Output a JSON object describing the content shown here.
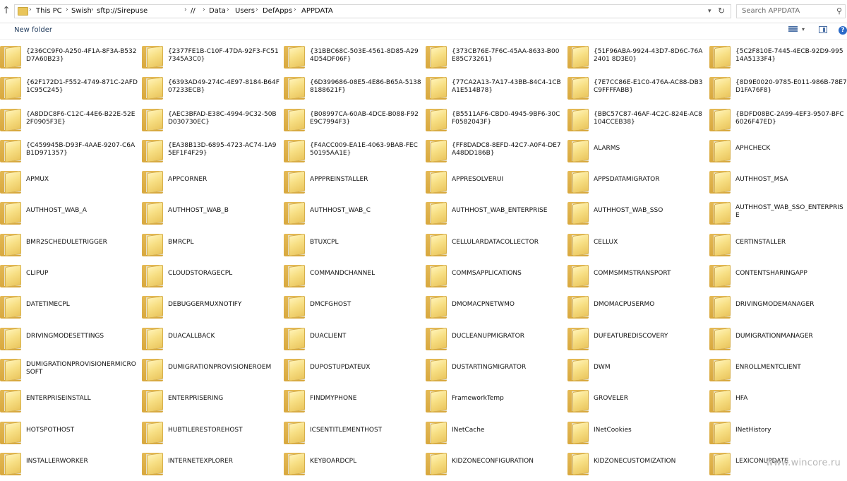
{
  "address": {
    "crumbs": [
      "This PC",
      "Swish",
      "sftp://Sirepuse",
      "//",
      "Data",
      "Users",
      "DefApps",
      "APPDATA"
    ]
  },
  "search": {
    "placeholder": "Search APPDATA"
  },
  "commands": {
    "new_folder": "New folder"
  },
  "items": [
    "{236CC9F0-A250-4F1A-8F3A-B532D7A60B23}",
    "{2377FE1B-C10F-47DA-92F3-FC517345A3C0}",
    "{31BBC68C-503E-4561-8D85-A294D54DF06F}",
    "{373CB76E-7F6C-45AA-8633-B00E85C73261}",
    "{51F96ABA-9924-43D7-8D6C-76A2401 8D3E0}",
    "{5C2F810E-7445-4ECB-92D9-99514A5133F4}",
    "{62F172D1-F552-4749-871C-2AFD1C95C245}",
    "{6393AD49-274C-4E97-8184-B64F07233ECB}",
    "{6D399686-08E5-4E86-B65A-51388188621F}",
    "{77CA2A13-7A17-43BB-84C4-1CBA1E514B78}",
    "{7E7CC86E-E1C0-476A-AC88-DB3C9FFFFABB}",
    "{8D9E0020-9785-E011-986B-78E7D1FA76F8}",
    "{A8DDC8F6-C12C-44E6-B22E-52E2F0905F3E}",
    "{AEC3BFAD-E38C-4994-9C32-50BD030730EC}",
    "{B08997CA-60AB-4DCE-B088-F92E9C7994F3}",
    "{B5511AF6-CBD0-4945-9BF6-30CF0582043F}",
    "{BBC57C87-46AF-4C2C-824E-AC8104CCEB38}",
    "{BDFD08BC-2A99-4EF3-9507-BFC6026F47ED}",
    "{C459945B-D93F-4AAE-9207-C6AB1D971357}",
    "{EA38B13D-6895-4723-AC74-1A95EF1F4F29}",
    "{F4ACC009-EA1E-4063-9BAB-FEC50195AA1E}",
    "{FF8DADC8-8EFD-42C7-A0F4-DE7A48DD186B}",
    "ALARMS",
    "APHCHECK",
    "APMUX",
    "APPCORNER",
    "APPPREINSTALLER",
    "APPRESOLVERUI",
    "APPSDATAMIGRATOR",
    "AUTHHOST_MSA",
    "AUTHHOST_WAB_A",
    "AUTHHOST_WAB_B",
    "AUTHHOST_WAB_C",
    "AUTHHOST_WAB_ENTERPRISE",
    "AUTHHOST_WAB_SSO",
    "AUTHHOST_WAB_SSO_ENTERPRISE",
    "BMR2SCHEDULETRIGGER",
    "BMRCPL",
    "BTUXCPL",
    "CELLULARDATACOLLECTOR",
    "CELLUX",
    "CERTINSTALLER",
    "CLIPUP",
    "CLOUDSTORAGECPL",
    "COMMANDCHANNEL",
    "COMMSAPPLICATIONS",
    "COMMSMMSTRANSPORT",
    "CONTENTSHARINGAPP",
    "DATETIMECPL",
    "DEBUGGERMUXNOTIFY",
    "DMCFGHOST",
    "DMOMACPNETWMO",
    "DMOMACPUSERMO",
    "DRIVINGMODEMANAGER",
    "DRIVINGMODESETTINGS",
    "DUACALLBACK",
    "DUACLIENT",
    "DUCLEANUPMIGRATOR",
    "DUFEATUREDISCOVERY",
    "DUMIGRATIONMANAGER",
    "DUMIGRATIONPROVISIONERMICROSOFT",
    "DUMIGRATIONPROVISIONEROEM",
    "DUPOSTUPDATEUX",
    "DUSTARTINGMIGRATOR",
    "DWM",
    "ENROLLMENTCLIENT",
    "ENTERPRISEINSTALL",
    "ENTERPRISERING",
    "FINDMYPHONE",
    "FrameworkTemp",
    "GROVELER",
    "HFA",
    "HOTSPOTHOST",
    "HUBTILERESTOREHOST",
    "ICSENTITLEMENTHOST",
    "INetCache",
    "INetCookies",
    "INetHistory",
    "INSTALLERWORKER",
    "INTERNETEXPLORER",
    "KEYBOARDCPL",
    "KIDZONECONFIGURATION",
    "KIDZONECUSTOMIZATION",
    "LEXICONUPDATE"
  ],
  "watermark": "www.wincore.ru"
}
